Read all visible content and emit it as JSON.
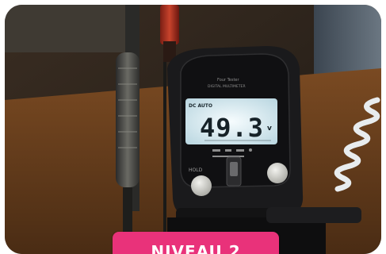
{
  "meter": {
    "mode_label": "DC AUTO",
    "reading": "49.3",
    "unit": "v",
    "header_line_1": "Four Tester",
    "header_line_2": "DIGITAL MULTIMETER",
    "hold_label": "HOLD"
  },
  "badge": {
    "text": "NIVEAU 2"
  },
  "colors": {
    "badge": "#e9327a",
    "lcd": "#e6f2f6",
    "meter_body": "#1a1a1c"
  }
}
